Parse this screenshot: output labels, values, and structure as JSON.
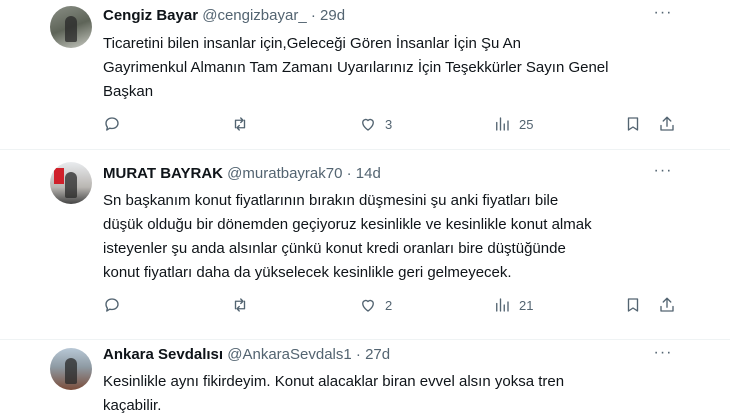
{
  "tweets": [
    {
      "name": "Cengiz Bayar",
      "handle": "@cengizbayar_",
      "time": "29d",
      "text": "Ticaretini bilen insanlar için,Geleceği Gören İnsanlar İçin Şu An\nGayrimenkul Almanın Tam Zamanı Uyarılarınız İçin Teşekkürler Sayın Genel\nBaşkan",
      "replies": "",
      "retweets": "",
      "likes": "3",
      "views": "25"
    },
    {
      "name": "MURAT BAYRAK",
      "handle": "@muratbayrak70",
      "time": "14d",
      "text": "Sn başkanım konut fiyatlarının bırakın düşmesini şu anki fiyatları  bile\ndüşük olduğu bir dönemden geçiyoruz kesinlikle ve kesinlikle konut almak\nisteyenler şu anda alsınlar çünkü konut kredi oranları bire düştüğünde\nkonut fiyatları daha da yükselecek kesinlikle geri gelmeyecek.",
      "replies": "",
      "retweets": "",
      "likes": "2",
      "views": "21"
    },
    {
      "name": "Ankara Sevdalısı",
      "handle": "@AnkaraSevdals1",
      "time": "27d",
      "text": "Kesinlikle aynı fikirdeyim. Konut alacaklar biran evvel alsın yoksa tren\nkaçabilir."
    }
  ],
  "separator": "·",
  "more_glyph": "···",
  "icons": {
    "reply": "reply-icon",
    "retweet": "retweet-icon",
    "like": "heart-icon",
    "views": "views-icon",
    "bookmark": "bookmark-icon",
    "share": "share-icon",
    "more": "more-icon"
  }
}
